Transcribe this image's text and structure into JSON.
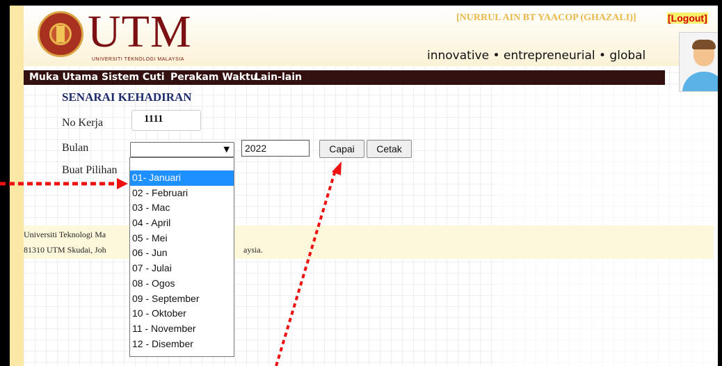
{
  "header": {
    "logo_text": "UTM",
    "logo_sub": "UNIVERSITI TEKNOLOGI MALAYSIA",
    "user_name": "[NURRUL AIN BT YAACOP (GHAZALI)]",
    "logout": "[Logout]",
    "tagline": "innovative • entrepreneurial • global"
  },
  "nav": {
    "items": [
      "Muka Utama",
      "Sistem Cuti",
      "Perakam Waktu",
      "Lain-lain"
    ]
  },
  "form": {
    "title": "SENARAI KEHADIRAN",
    "no_kerja_label": "No Kerja",
    "no_kerja_value": "1111",
    "bulan_label": "Bulan",
    "buat_pilihan_label": "Buat Pilihan",
    "year_value": "2022",
    "capai_button": "Capai",
    "cetak_button": "Cetak"
  },
  "dropdown": {
    "selected_index": 0,
    "options": [
      "01- Januari",
      "02 - Februari",
      "03 - Mac",
      "04 - April",
      "05 - Mei",
      "06 - Jun",
      "07 - Julai",
      "08 - Ogos",
      "09 - September",
      "10 - Oktober",
      "11 - November",
      "12 - Disember"
    ]
  },
  "footer": {
    "line1": "Universiti Teknologi Ma",
    "line2_prefix": "81310 UTM Skudai, Joh",
    "line2_suffix": "aysia."
  },
  "colors": {
    "nav_bg": "#331111",
    "brand": "#7b1113",
    "selection": "#1e90ff",
    "annotation_arrow": "#ee1111"
  }
}
